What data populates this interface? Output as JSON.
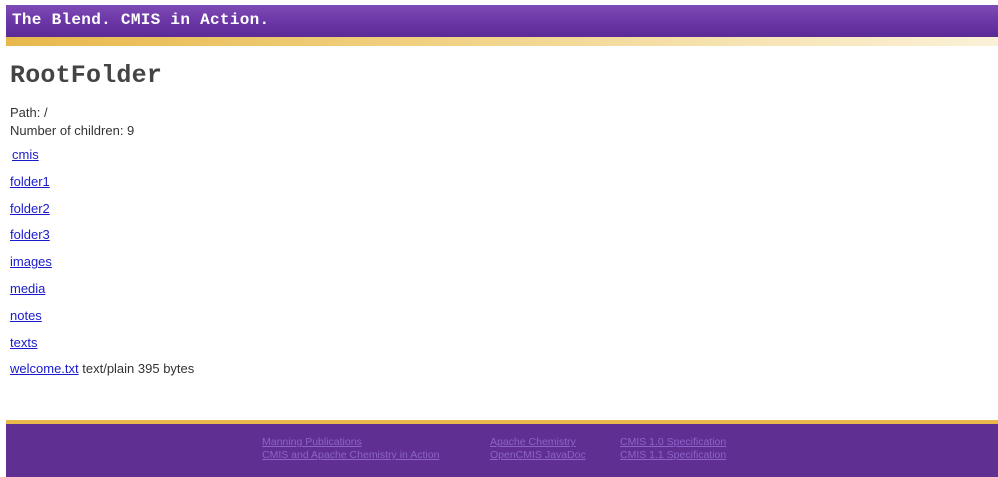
{
  "header": {
    "title": "The Blend. CMIS in Action."
  },
  "folder": {
    "name": "RootFolder",
    "path_text": "Path: /",
    "children_count_text": "Number of children: 9"
  },
  "children": [
    {
      "name": "cmis"
    },
    {
      "name": "folder1"
    },
    {
      "name": "folder2"
    },
    {
      "name": "folder3"
    },
    {
      "name": "images"
    },
    {
      "name": "media"
    },
    {
      "name": "notes"
    },
    {
      "name": "texts"
    },
    {
      "name": "welcome.txt",
      "info": " text/plain 395 bytes"
    }
  ],
  "footer": {
    "links": [
      {
        "label": "Manning Publications"
      },
      {
        "label": "CMIS and Apache Chemistry in Action"
      },
      {
        "label": "Apache Chemistry"
      },
      {
        "label": "OpenCMIS JavaDoc"
      },
      {
        "label": "CMIS 1.0 Specification"
      },
      {
        "label": "CMIS 1.1 Specification"
      }
    ]
  },
  "colors": {
    "header_purple": "#6a35a5",
    "accent_gold": "#e8b84b",
    "footer_purple": "#5f2f92",
    "link_blue": "#1a1acc",
    "footer_link": "#8d63c8"
  }
}
